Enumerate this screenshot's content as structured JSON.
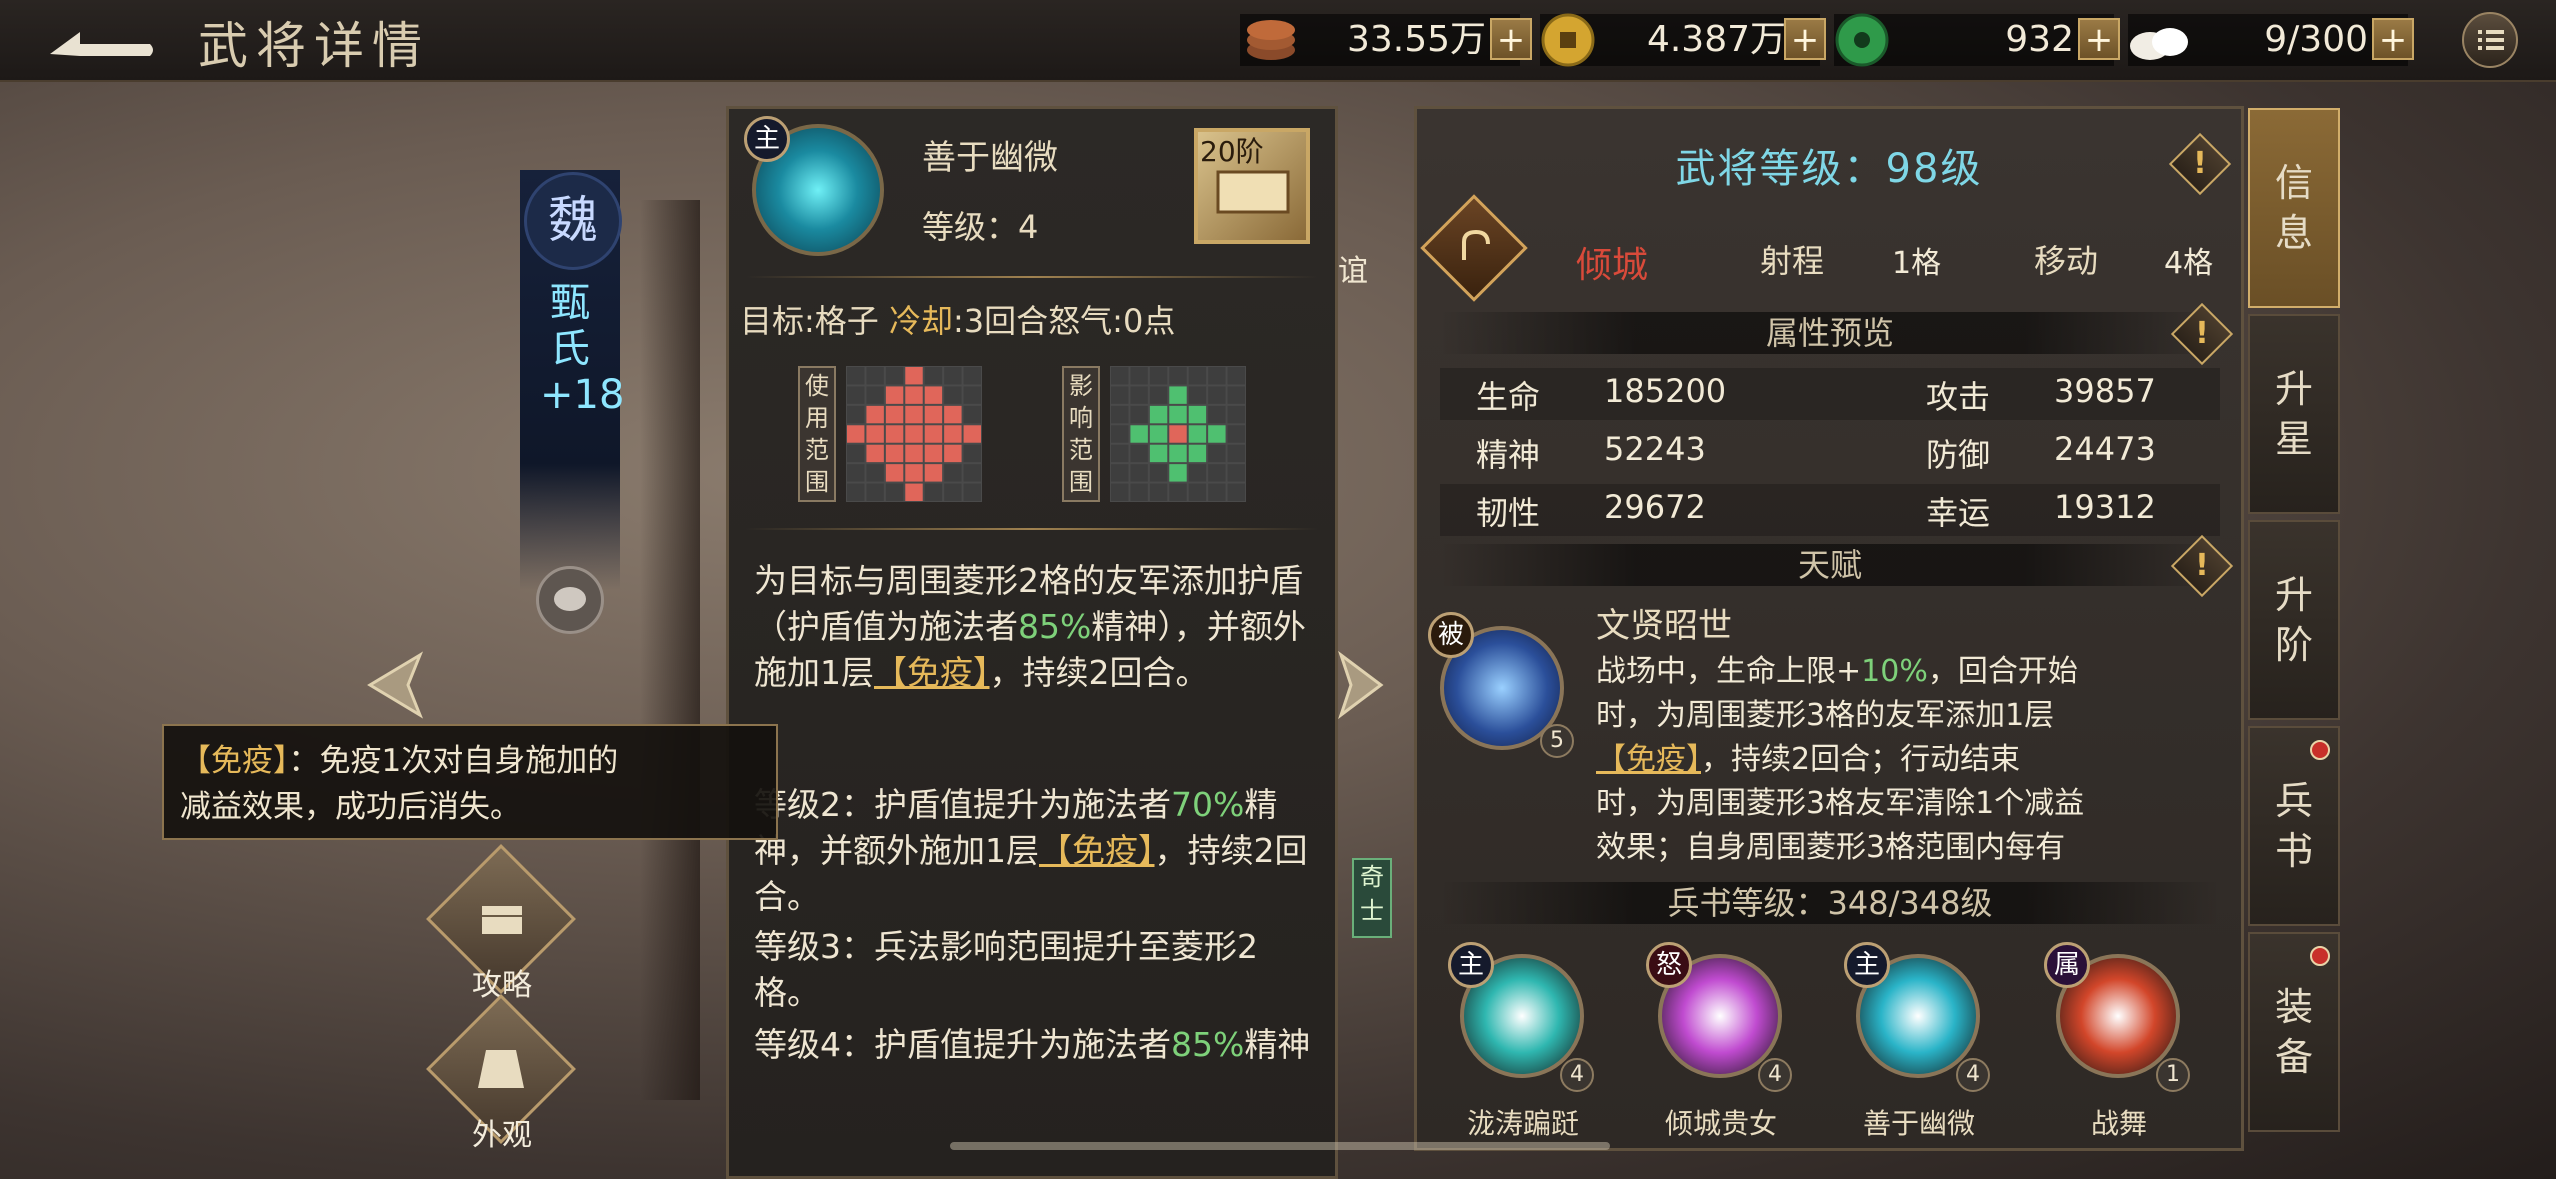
{
  "header": {
    "title": "武将详情",
    "resources": [
      {
        "icon": "copper-coins-icon",
        "value": "33.55万"
      },
      {
        "icon": "gold-coin-icon",
        "value": "4.387万"
      },
      {
        "icon": "jade-icon",
        "value": "932"
      },
      {
        "icon": "steamed-bun-icon",
        "value": "9/300"
      }
    ]
  },
  "hero": {
    "faction": "魏",
    "name": "甄氏+18",
    "side_buttons": [
      {
        "label": "攻略"
      },
      {
        "label": "外观"
      }
    ]
  },
  "tooltip": {
    "keyword": "【免疫】",
    "text_a": "：免疫1次对自身施加的",
    "text_b": "减益效果，成功后消失。"
  },
  "skill": {
    "type_tag": "主",
    "name": "善于幽微",
    "level": "等级：4",
    "rank": "20阶",
    "target_label": "目标",
    "target_value": "格子",
    "cooldown_label": "冷却",
    "cooldown_value": "3回合",
    "rage_label": "怒气",
    "rage_value": "0点",
    "use_range_label": "使用范围",
    "effect_range_label": "影响范围",
    "desc1_a": "为目标与周围菱形2格的友军添加护盾（护盾值为施法者",
    "desc1_pct": "85%",
    "desc1_b": "精神），并额外施加1层",
    "desc1_kw": "【免疫】",
    "desc1_c": "，持续2回合。",
    "lvl2_a": "等级2：护盾值提升为施法者",
    "lvl2_pct": "70%",
    "lvl2_b": "精神，并额外施加1层",
    "lvl2_kw": "【免疫】",
    "lvl2_c": "，持续2回合。",
    "lvl3": "等级3：兵法影响范围提升至菱形2格。",
    "lvl4_a": "等级4：护盾值提升为施法者",
    "lvl4_pct": "85%",
    "lvl4_b": "精神"
  },
  "partial_labels": {
    "a": "谊",
    "b": "奇士"
  },
  "info": {
    "level_title": "武将等级：98级",
    "class_name": "倾城",
    "range_label": "射程",
    "range_value": "1格",
    "move_label": "移动",
    "move_value": "4格",
    "attr_section": "属性预览",
    "attrs": [
      {
        "label": "生命",
        "value": "185200"
      },
      {
        "label": "攻击",
        "value": "39857"
      },
      {
        "label": "精神",
        "value": "52243"
      },
      {
        "label": "防御",
        "value": "24473"
      },
      {
        "label": "韧性",
        "value": "29672"
      },
      {
        "label": "幸运",
        "value": "19312"
      }
    ],
    "talent_section": "天赋",
    "talent": {
      "tag": "被",
      "level": "5",
      "name": "文贤昭世",
      "line1_a": "战场中，生命上限+",
      "line1_pct": "10%",
      "line1_b": "，回合开始",
      "line2": "时，为周围菱形3格的友军添加1层",
      "line3_kw": "【免疫】",
      "line3_b": "，持续2回合；行动结束",
      "line4": "时，为周围菱形3格友军清除1个减益",
      "line5": "效果；自身周围菱形3格范围内每有"
    },
    "book_section": "兵书等级：348/348级",
    "skills": [
      {
        "tag": "主",
        "name": "泷涛蹁跹",
        "level": "4",
        "color": "#2fb7b0"
      },
      {
        "tag": "怒",
        "name": "倾城贵女",
        "level": "4",
        "color": "#c04bd0"
      },
      {
        "tag": "主",
        "name": "善于幽微",
        "level": "4",
        "color": "#2ab4c8"
      },
      {
        "tag": "属",
        "name": "战舞",
        "level": "1",
        "color": "#d2462a"
      }
    ]
  },
  "tabs": [
    {
      "label": "信息",
      "active": true
    },
    {
      "label": "升星"
    },
    {
      "label": "升阶"
    },
    {
      "label": "兵书"
    },
    {
      "label": "装备"
    }
  ],
  "colors": {
    "accent_gold": "#e6b95a",
    "highlight_green": "#7ed17a",
    "title_cyan": "#7fd7e6",
    "class_red": "#d94a3a"
  }
}
